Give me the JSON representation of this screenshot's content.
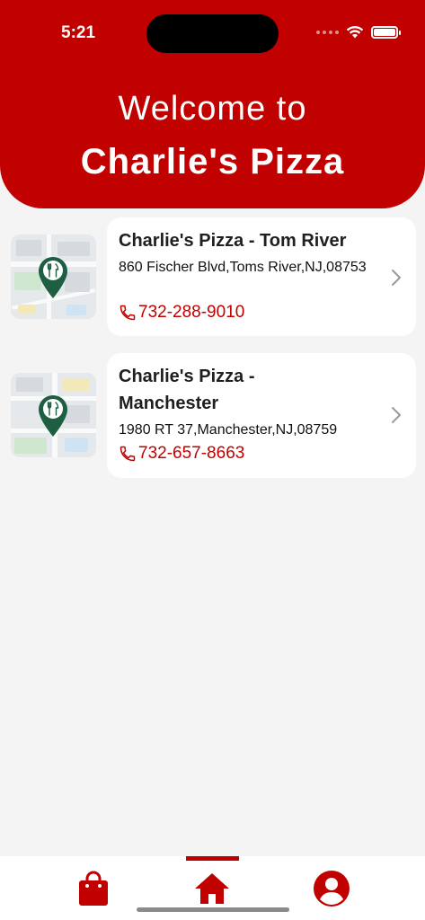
{
  "status_bar": {
    "time": "5:21"
  },
  "header": {
    "welcome": "Welcome to",
    "brand": "Charlie's Pizza"
  },
  "stores": [
    {
      "name": "Charlie's Pizza - Tom River",
      "address": "860 Fischer Blvd,Toms River,NJ,08753",
      "phone": "732-288-9010"
    },
    {
      "name": "Charlie's Pizza - Manchester",
      "address": "1980 RT 37,Manchester,NJ,08759",
      "phone": "732-657-8663"
    }
  ],
  "icons": {
    "map_pin": "restaurant-pin-icon",
    "phone": "phone-icon",
    "chevron": "chevron-right-icon",
    "tab_orders": "shopping-bag-icon",
    "tab_home": "home-icon",
    "tab_account": "account-icon"
  },
  "tabbar": {
    "active": "home"
  },
  "colors": {
    "brand": "#c10000",
    "pin": "#1e5e43",
    "background": "#f4f4f4"
  }
}
